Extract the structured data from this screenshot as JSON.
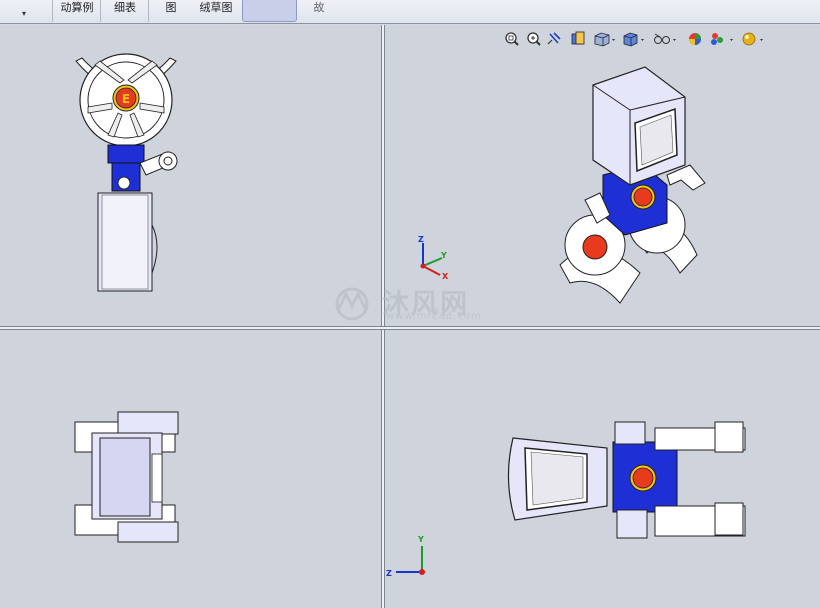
{
  "toolbar": {
    "dropdown_glyph": "▾",
    "tabs": [
      {
        "label": "动算例"
      },
      {
        "label": "细表"
      },
      {
        "label": "图"
      },
      {
        "label": "绒草图"
      },
      {
        "label": "故"
      }
    ]
  },
  "hud_icons": [
    "zoom-to-fit-icon",
    "zoom-to-area-icon",
    "previous-view-icon",
    "section-view-icon",
    "view-orientation-icon",
    "display-style-icon",
    "hide-show-items-icon",
    "edit-appearance-icon",
    "apply-scene-icon",
    "view-settings-icon"
  ],
  "triad": {
    "iso": {
      "x": "X",
      "y": "Y",
      "z": "Z"
    },
    "top": {
      "y": "Y",
      "z": "Z"
    }
  },
  "badge_letter": "E",
  "watermark": {
    "text": "沐风网",
    "url": "www.mfcad.com"
  },
  "colors": {
    "viewport": "#cfd3dc",
    "part_white": "#ffffff",
    "part_lavender": "#e6e6fa",
    "part_blue": "#1f2fd6",
    "badge_red": "#e83a1c",
    "badge_yellow": "#f2c11a",
    "axis_x": "#d0201f",
    "axis_y": "#1e9a2a",
    "axis_z": "#1b34c8"
  }
}
